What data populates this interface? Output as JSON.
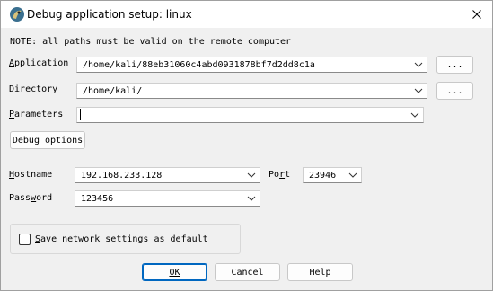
{
  "window": {
    "title": "Debug application setup: linux",
    "icon": "ida-app-icon",
    "close_icon": "close-icon"
  },
  "note": "NOTE: all paths must be valid on the remote computer",
  "fields": {
    "application": {
      "label": "Application",
      "value": "/home/kali/88eb31060c4abd0931878bf7d2dd8c1a",
      "browse_label": "..."
    },
    "directory": {
      "label": "Directory",
      "value": "/home/kali/",
      "browse_label": "..."
    },
    "parameters": {
      "label": "Parameters",
      "value": ""
    },
    "hostname": {
      "label": "Hostname",
      "value": "192.168.233.128"
    },
    "port": {
      "label": "Port",
      "value": "23946"
    },
    "password": {
      "label": "Password",
      "value": "123456"
    }
  },
  "buttons": {
    "debug_options": "Debug options",
    "ok": "OK",
    "cancel": "Cancel",
    "help": "Help"
  },
  "checkbox": {
    "label": "Save network settings as default",
    "checked": false
  }
}
